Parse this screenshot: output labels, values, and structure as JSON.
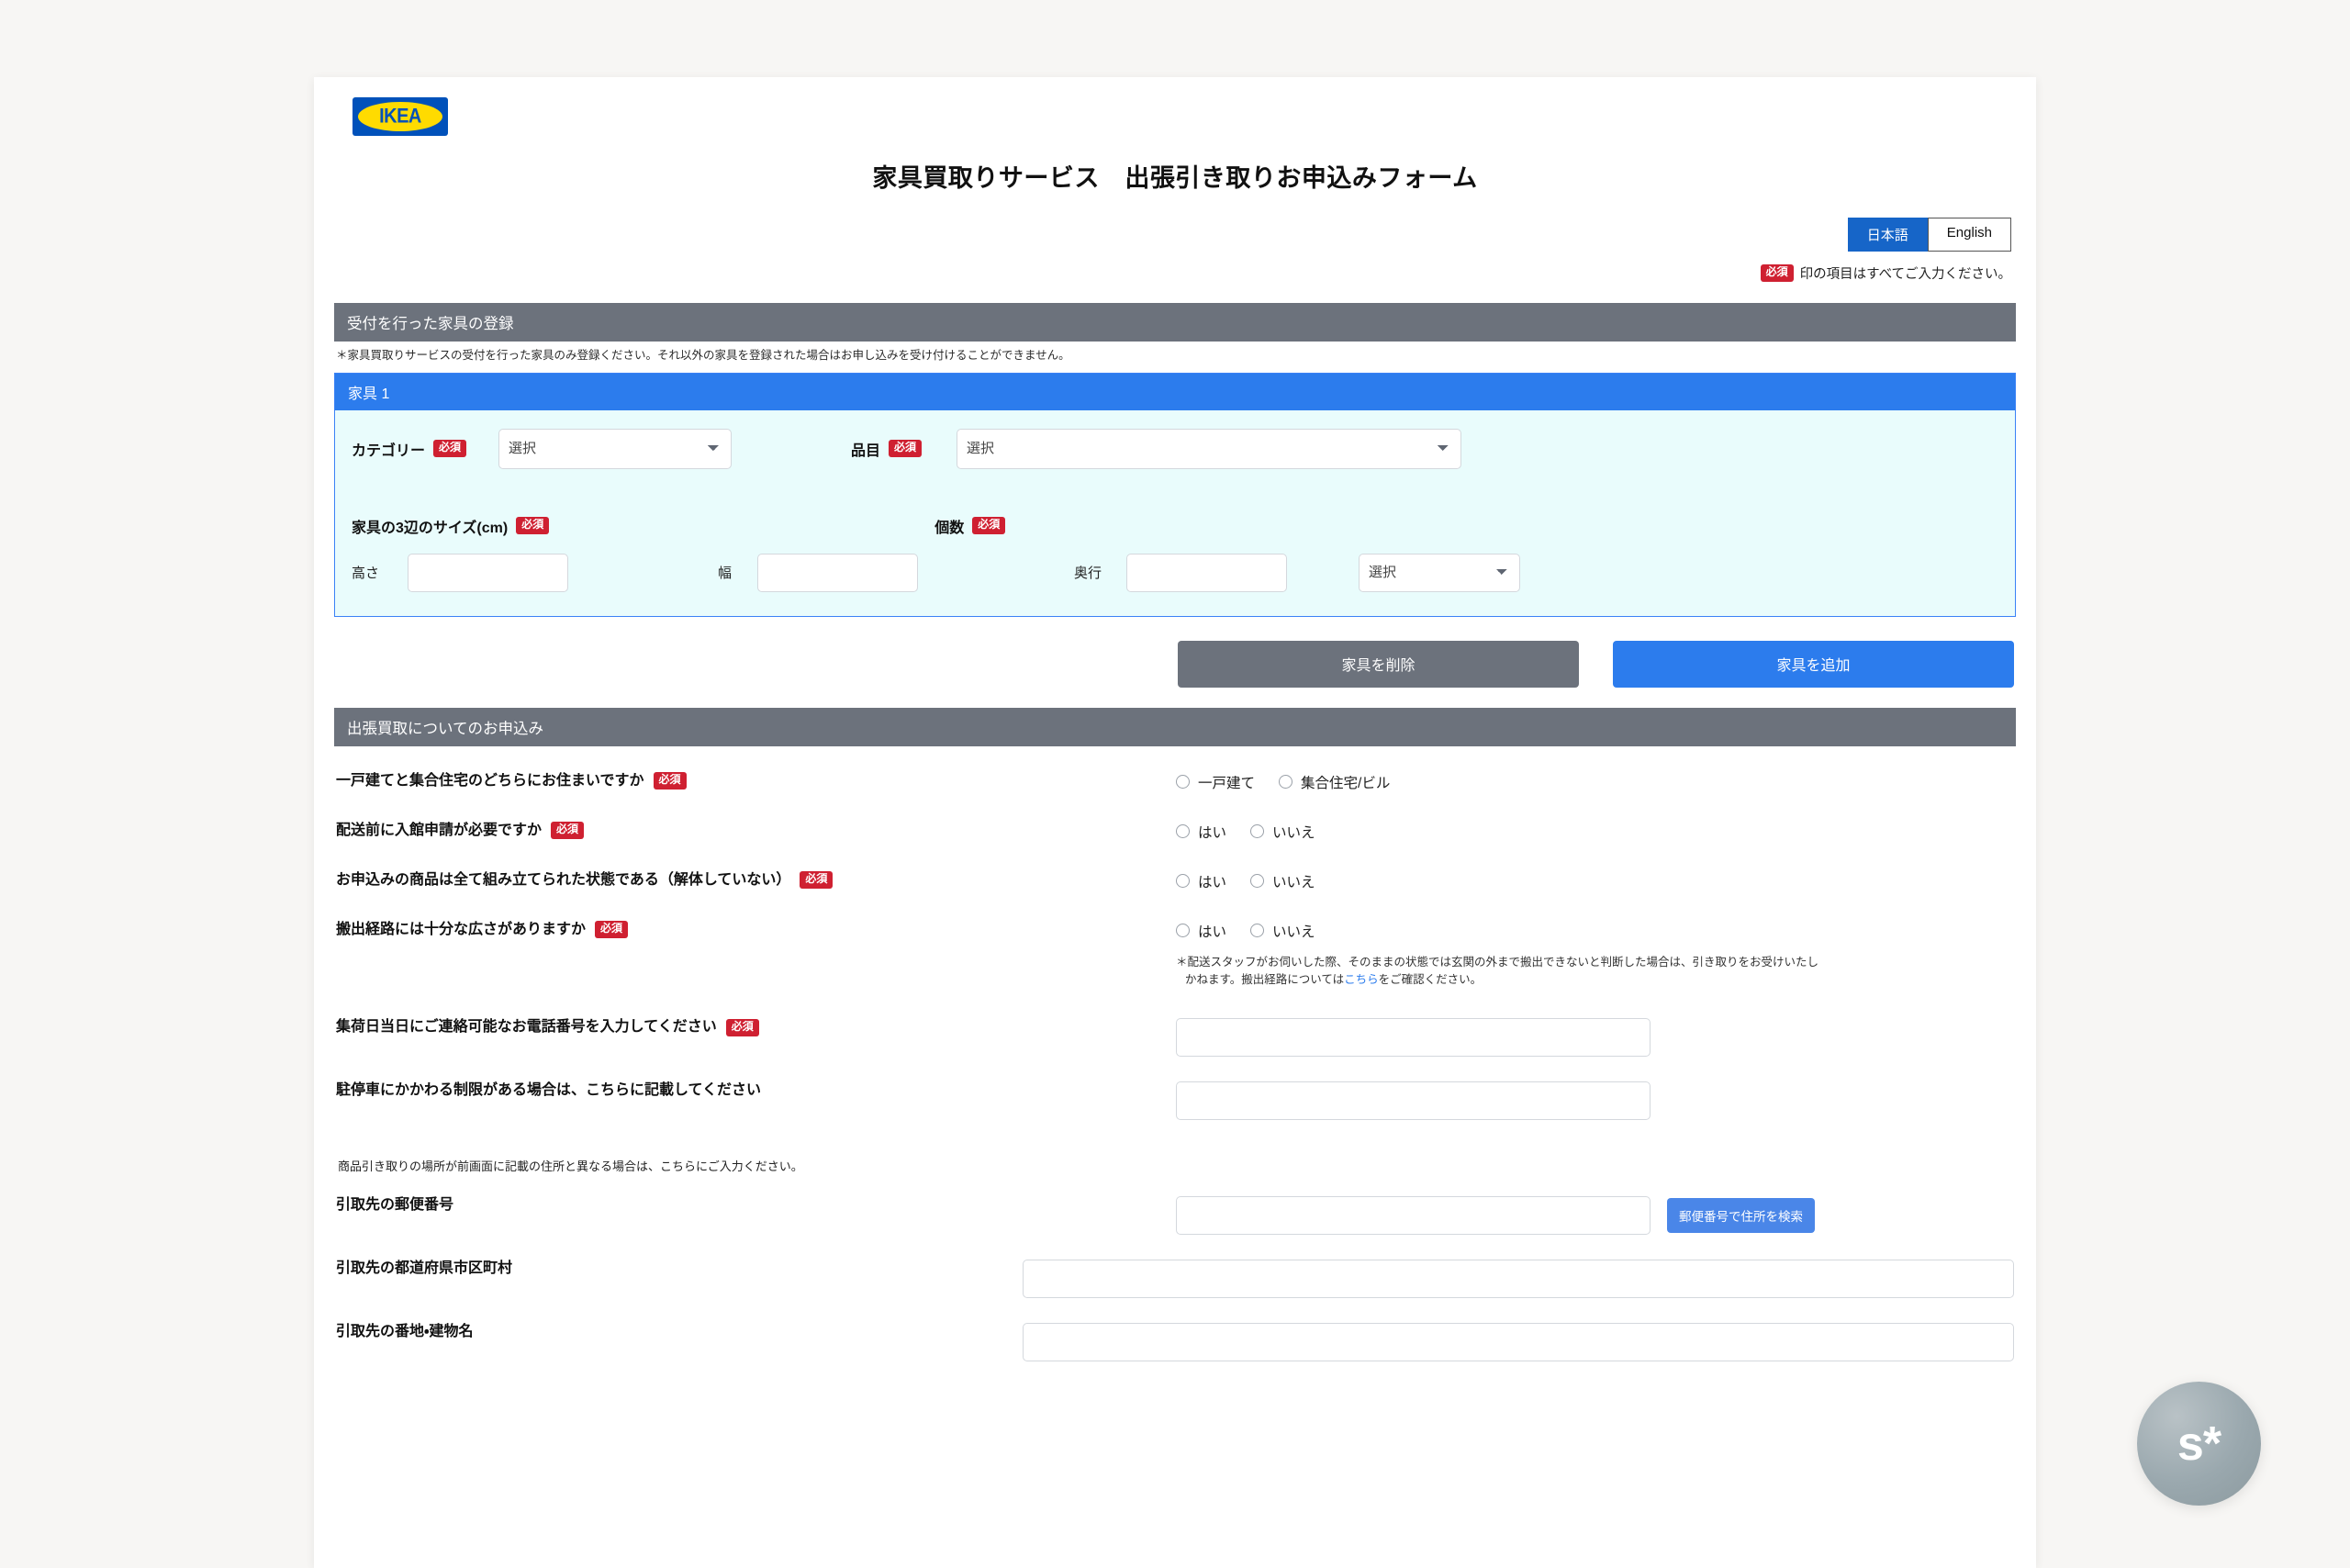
{
  "brand": {
    "logo_text": "IKEA"
  },
  "header": {
    "title": "家具買取りサービス　出張引き取りお申込みフォーム",
    "lang_ja": "日本語",
    "lang_en": "English",
    "required_badge": "必須",
    "required_note": "印の項目はすべてご入力ください。"
  },
  "section_furniture": {
    "bar_title": "受付を行った家具の登録",
    "note": "＊家具買取りサービスの受付を行った家具のみ登録ください。それ以外の家具を登録された場合はお申し込みを受け付けることができません。",
    "card_title": "家具 1",
    "category_label": "カテゴリー",
    "category_badge": "必須",
    "category_value": "選択",
    "item_label": "品目",
    "item_badge": "必須",
    "item_value": "選択",
    "size_label": "家具の3辺のサイズ(cm)",
    "size_badge": "必須",
    "height_label": "高さ",
    "width_label": "幅",
    "depth_label": "奥行",
    "height_value": "",
    "width_value": "",
    "depth_value": "",
    "qty_label": "個数",
    "qty_badge": "必須",
    "qty_value": "選択",
    "delete_button": "家具を削除",
    "add_button": "家具を追加"
  },
  "section_pickup": {
    "bar_title": "出張買取についてのお申込み",
    "q_housing": {
      "label": "一戸建てと集合住宅のどちらにお住まいですか",
      "badge": "必須",
      "opt1": "一戸建て",
      "opt2": "集合住宅/ビル"
    },
    "q_entry": {
      "label": "配送前に入館申請が必要ですか",
      "badge": "必須",
      "opt1": "はい",
      "opt2": "いいえ"
    },
    "q_assembled": {
      "label": "お申込みの商品は全て組み立てられた状態である（解体していない）",
      "badge": "必須",
      "opt1": "はい",
      "opt2": "いいえ"
    },
    "q_route": {
      "label": "搬出経路には十分な広さがありますか",
      "badge": "必須",
      "opt1": "はい",
      "opt2": "いいえ",
      "hint_line1": "＊配送スタッフがお伺いした際、そのままの状態では玄関の外まで搬出できないと判断した場合は、引き取りをお受けいたし",
      "hint_line2_pre": "かねます。搬出経路については",
      "hint_link": "こちら",
      "hint_line2_post": "をご確認ください。"
    },
    "phone": {
      "label": "集荷日当日にご連絡可能なお電話番号を入力してください",
      "badge": "必須",
      "value": ""
    },
    "parking": {
      "label": "駐停車にかかわる制限がある場合は、こちらに記載してください",
      "value": ""
    },
    "address_note": "商品引き取りの場所が前画面に記載の住所と異なる場合は、こちらにご入力ください。",
    "zip": {
      "label": "引取先の郵便番号",
      "value": "",
      "search_button": "郵便番号で住所を検索"
    },
    "prefecture": {
      "label": "引取先の都道府県市区町村",
      "value": ""
    },
    "building": {
      "label": "引取先の番地・建物名",
      "value": ""
    }
  },
  "float_badge": {
    "text": "s*"
  },
  "colors": {
    "brand_blue": "#0051ba",
    "brand_yellow": "#ffdb00",
    "accent_blue": "#2c7ced",
    "section_gray": "#6c727c",
    "required_red": "#cf2031",
    "card_bg": "#e9fcfc"
  }
}
